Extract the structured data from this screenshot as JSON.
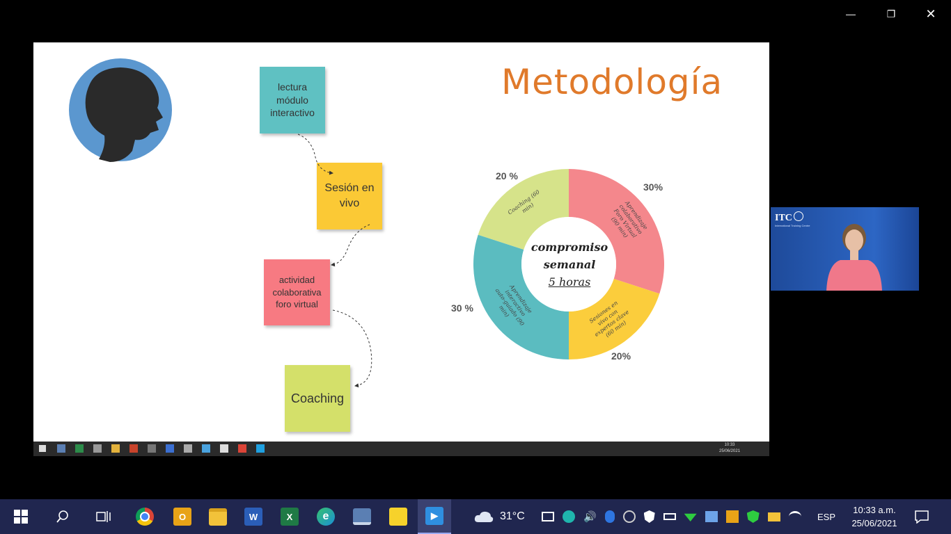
{
  "window": {
    "minimize_icon": "minimize-icon",
    "maximize_icon": "restore-icon",
    "close_icon": "close-icon"
  },
  "slide": {
    "title": "Metodología",
    "notes": [
      {
        "text": "lectura\nmódulo\ninteractivo",
        "color": "#5fc1c2"
      },
      {
        "text": "Sesión en\nvivo",
        "color": "#fbc935"
      },
      {
        "text": "actividad\ncolaborativa\nforo virtual",
        "color": "#f77a82"
      },
      {
        "text": "Coaching",
        "color": "#d4e06a"
      }
    ],
    "donut": {
      "center_line1": "compromiso",
      "center_line2": "semanal",
      "center_line3": "5 horas",
      "segments": [
        {
          "label": "Aprendizaje colaborativo Foro Virtual (90 min)",
          "percent": 30,
          "percent_label": "30%",
          "color": "#f4878c"
        },
        {
          "label": "Sesiones en vivo con expertos clave (60 min)",
          "percent": 20,
          "percent_label": "20%",
          "color": "#fbcd3c"
        },
        {
          "label": "Aprendizaje interactivo auto-guiado (90 min)",
          "percent": 30,
          "percent_label": "30 %",
          "color": "#5bbcc0"
        },
        {
          "label": "Coaching (60 min)",
          "percent": 20,
          "percent_label": "20 %",
          "color": "#d6e38a"
        }
      ]
    }
  },
  "webcam": {
    "logo": "ITC",
    "subtitle": "International Training Centre"
  },
  "inner_taskbar": {
    "time": "10:33",
    "date": "25/06/2021"
  },
  "taskbar": {
    "apps": [
      {
        "name": "chrome-icon",
        "glyph": "",
        "color": "#db4437"
      },
      {
        "name": "outlook-icon",
        "glyph": "O",
        "color": "#e8a317"
      },
      {
        "name": "file-explorer-icon",
        "glyph": "",
        "color": "#f2c23a"
      },
      {
        "name": "word-icon",
        "glyph": "W",
        "color": "#2b5eb8"
      },
      {
        "name": "excel-icon",
        "glyph": "X",
        "color": "#1f7a45"
      },
      {
        "name": "edge-icon",
        "glyph": "e",
        "color": "#1b8fd6"
      },
      {
        "name": "remote-desktop-icon",
        "glyph": "",
        "color": "#5b7fb3"
      },
      {
        "name": "sticky-notes-icon",
        "glyph": "",
        "color": "#f6d22b"
      },
      {
        "name": "media-player-icon",
        "glyph": "▶",
        "color": "#2f8fe0"
      }
    ],
    "weather": "31°C",
    "language": "ESP",
    "time": "10:33 a.m.",
    "date": "25/06/2021"
  }
}
